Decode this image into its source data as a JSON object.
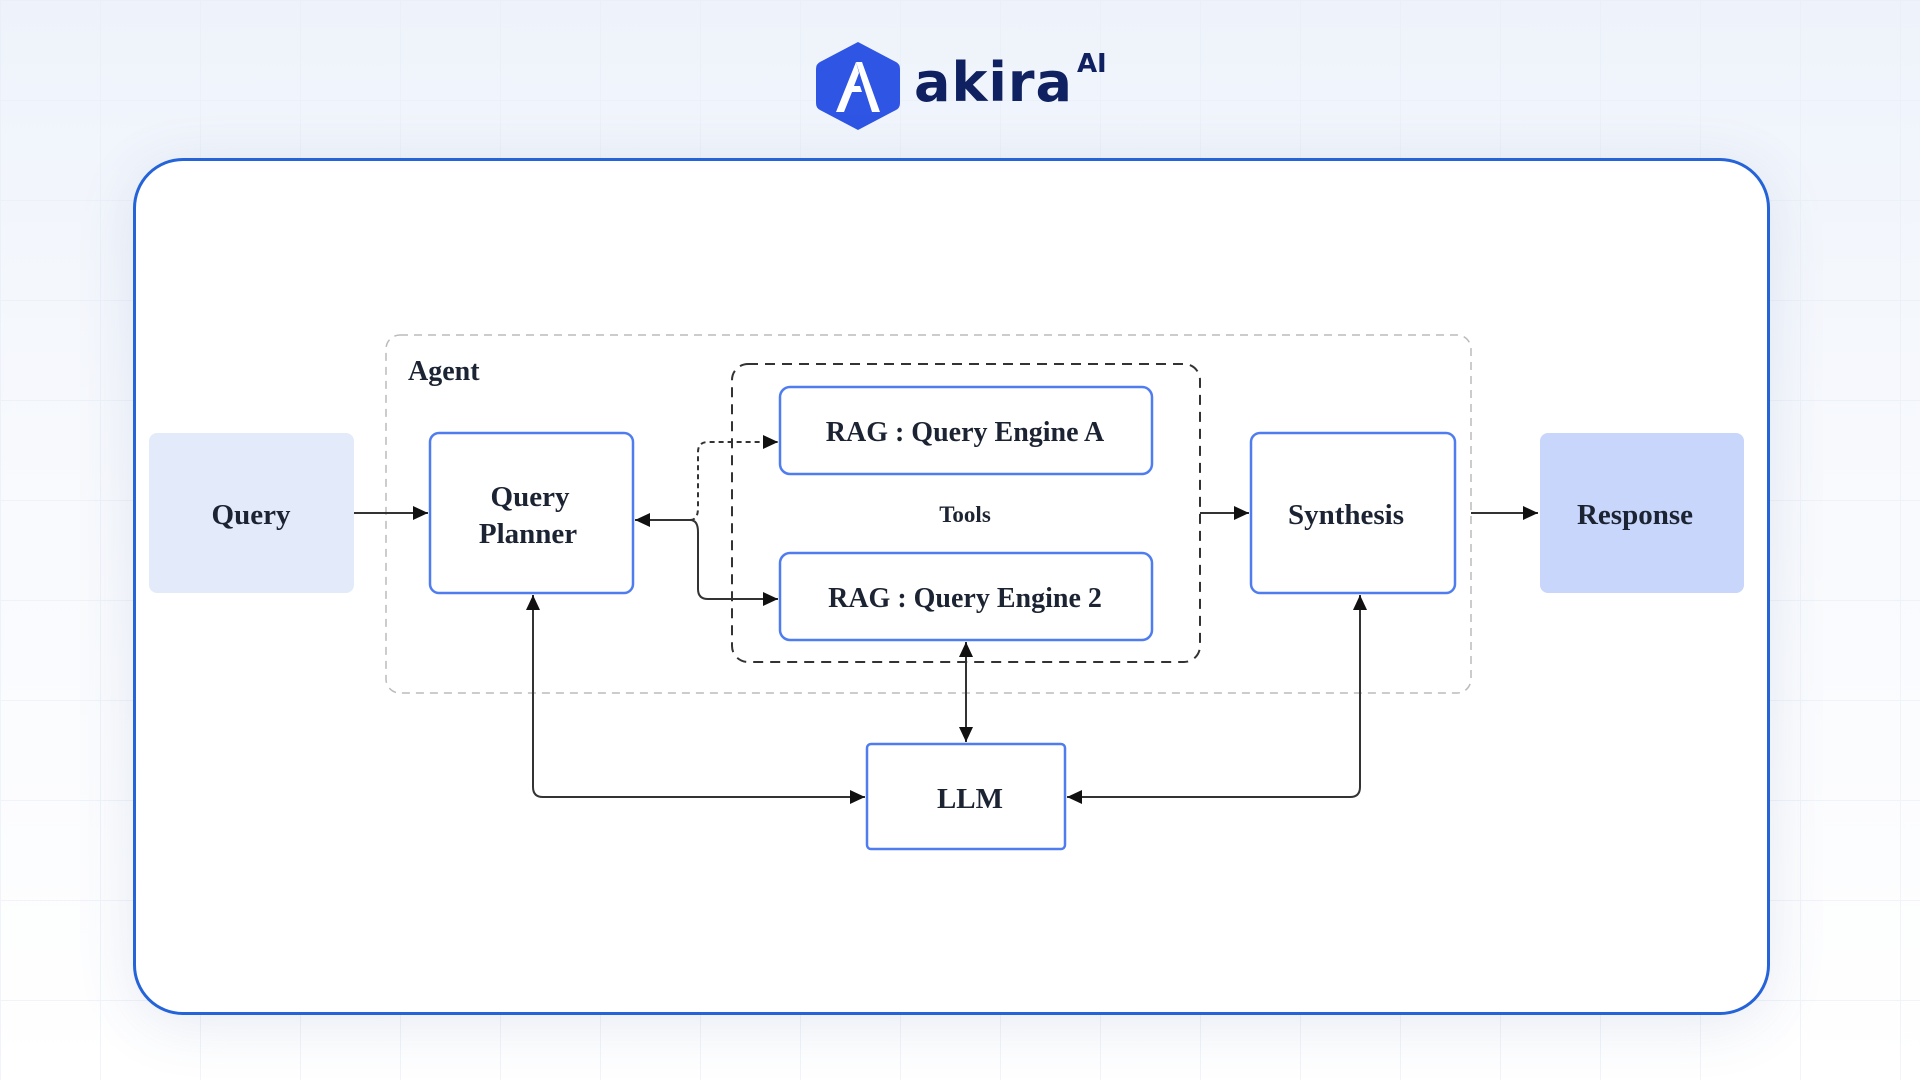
{
  "brand": {
    "name": "akira",
    "superscript": "AI",
    "color": "#2f55e4"
  },
  "diagram": {
    "agent_label": "Agent",
    "tools_label": "Tools",
    "nodes": {
      "query": "Query",
      "planner_line1": "Query",
      "planner_line2": "Planner",
      "engine_a": "RAG : Query Engine A",
      "engine_2": "RAG : Query Engine 2",
      "synthesis": "Synthesis",
      "response": "Response",
      "llm": "LLM"
    },
    "colors": {
      "node_border": "#4f7df0",
      "query_fill": "#e3ebfb",
      "response_fill": "#c9d6fb",
      "card_border": "#2563d9"
    }
  }
}
